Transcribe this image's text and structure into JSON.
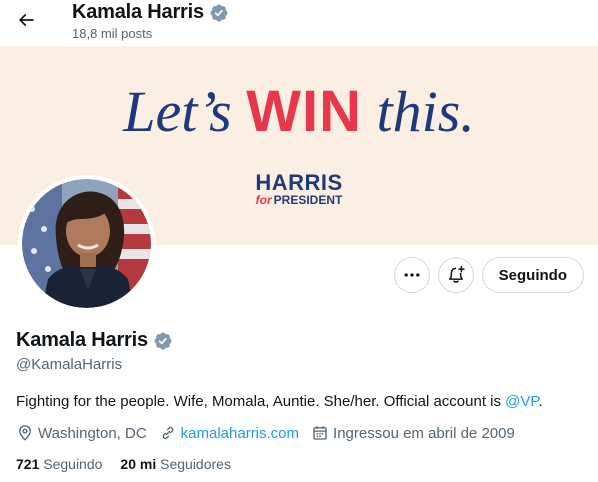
{
  "header": {
    "back_icon": "arrow-left-icon",
    "name": "Kamala Harris",
    "verified_icon": "verified-badge-icon",
    "posts_count": "18,8 mil posts"
  },
  "banner": {
    "headline_part1": "Let’s",
    "headline_part2": "WIN",
    "headline_part3": "this.",
    "campaign_name": "HARRIS",
    "campaign_for": "for",
    "campaign_title": "PRESIDENT",
    "colors": {
      "background": "#fbefe3",
      "navy": "#1f3a7a",
      "red": "#e8364a"
    }
  },
  "actions": {
    "more_icon": "more-horizontal-icon",
    "notify_icon": "bell-plus-icon",
    "follow_label": "Seguindo"
  },
  "profile": {
    "name": "Kamala Harris",
    "handle": "@KamalaHarris",
    "bio_text": "Fighting for the people. Wife, Momala, Auntie. She/her. Official account is ",
    "bio_link": "@VP",
    "bio_end": ".",
    "location": "Washington, DC",
    "website": "kamalaharris.com",
    "joined": "Ingressou em abril de 2009",
    "following_count": "721",
    "following_label": "Seguindo",
    "followers_count": "20 mi",
    "followers_label": "Seguidores"
  },
  "colors": {
    "accent": "#1d9bf0",
    "verified": "#829aab",
    "muted": "#536471"
  }
}
